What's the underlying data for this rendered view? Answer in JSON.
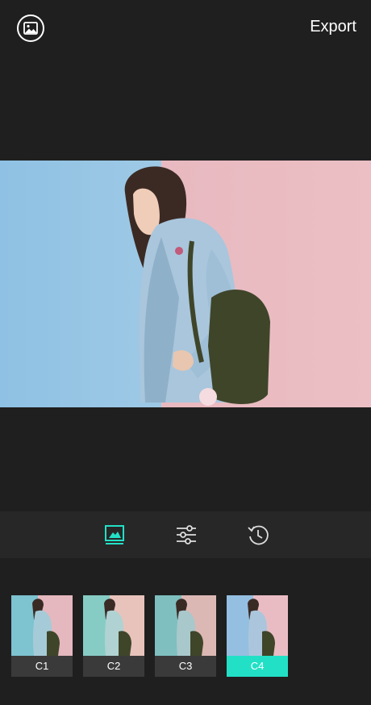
{
  "header": {
    "export_label": "Export"
  },
  "colors": {
    "accent": "#22e0c6",
    "background": "#1f1f1f",
    "toolbar": "#272727"
  },
  "toolbar": {
    "items": [
      {
        "icon": "image-filter-icon",
        "active": true
      },
      {
        "icon": "adjust-sliders-icon",
        "active": false
      },
      {
        "icon": "history-icon",
        "active": false
      }
    ]
  },
  "filters": [
    {
      "label": "C1",
      "selected": false
    },
    {
      "label": "C2",
      "selected": false
    },
    {
      "label": "C3",
      "selected": false
    },
    {
      "label": "C4",
      "selected": true
    }
  ]
}
